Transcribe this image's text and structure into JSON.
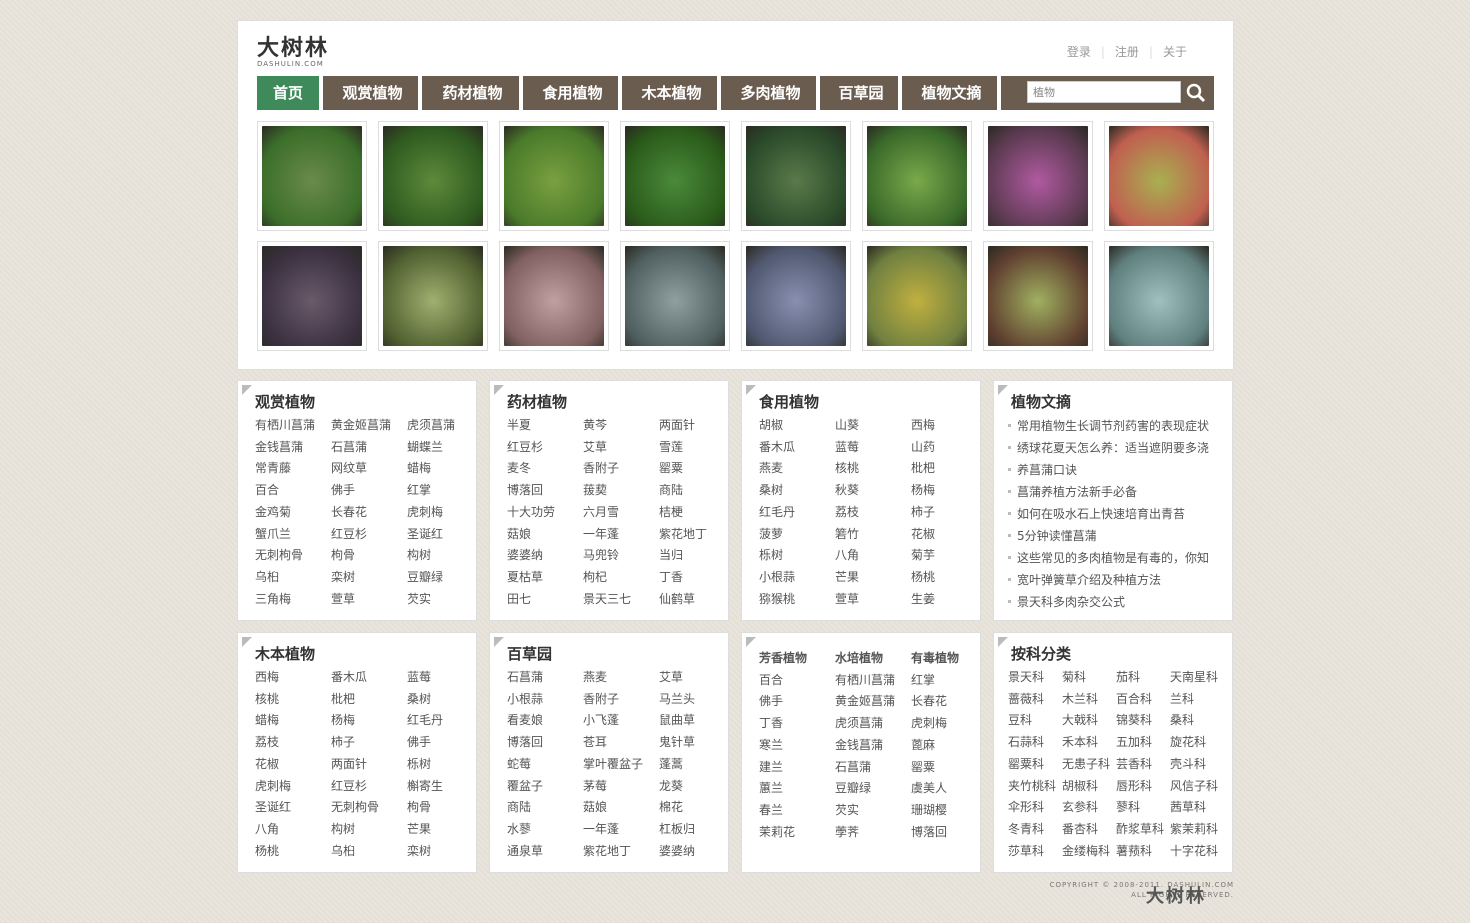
{
  "logo": {
    "main": "大树林",
    "sub": "DASHULIN.COM"
  },
  "toplinks": [
    "登录",
    "注册",
    "关于"
  ],
  "nav": [
    {
      "label": "首页",
      "active": true
    },
    {
      "label": "观赏植物"
    },
    {
      "label": "药材植物"
    },
    {
      "label": "食用植物"
    },
    {
      "label": "木本植物"
    },
    {
      "label": "多肉植物"
    },
    {
      "label": "百草园"
    },
    {
      "label": "植物文摘"
    }
  ],
  "search": {
    "value": "植物"
  },
  "thumb_colors": [
    [
      "#6a8a4a",
      "#3b6e2a"
    ],
    [
      "#5d8a3a",
      "#2f5a20"
    ],
    [
      "#7aa040",
      "#4a7a2a"
    ],
    [
      "#4a8a3a",
      "#2a5a1a"
    ],
    [
      "#5a7a4a",
      "#2a4a2a"
    ],
    [
      "#7aa84a",
      "#3a6a2a"
    ],
    [
      "#b05aa0",
      "#5a3a50"
    ],
    [
      "#a8b050",
      "#c06050"
    ],
    [
      "#6a5a6a",
      "#3a3040"
    ],
    [
      "#a0b070",
      "#506030"
    ],
    [
      "#c0a0a0",
      "#806060"
    ],
    [
      "#90a0a0",
      "#506060"
    ],
    [
      "#8890b0",
      "#505870"
    ],
    [
      "#c0b040",
      "#708040"
    ],
    [
      "#a0b060",
      "#604030"
    ],
    [
      "#a0c0c0",
      "#608080"
    ]
  ],
  "boxes": {
    "ornamental": {
      "title": "观赏植物",
      "cols": [
        [
          "有栖川菖蒲",
          "金钱菖蒲",
          "常青藤",
          "百合",
          "金鸡菊",
          "蟹爪兰",
          "无刺枸骨",
          "乌桕",
          "三角梅"
        ],
        [
          "黄金姬菖蒲",
          "石菖蒲",
          "网纹草",
          "佛手",
          "长春花",
          "红豆杉",
          "枸骨",
          "栾树",
          "萱草"
        ],
        [
          "虎须菖蒲",
          "蝴蝶兰",
          "蜡梅",
          "红掌",
          "虎刺梅",
          "圣诞红",
          "构树",
          "豆瓣绿",
          "芡实"
        ]
      ]
    },
    "medicinal": {
      "title": "药材植物",
      "cols": [
        [
          "半夏",
          "红豆杉",
          "麦冬",
          "博落回",
          "十大功劳",
          "菇娘",
          "婆婆纳",
          "夏枯草",
          "田七"
        ],
        [
          "黄芩",
          "艾草",
          "香附子",
          "菝葜",
          "六月雪",
          "一年蓬",
          "马兜铃",
          "枸杞",
          "景天三七"
        ],
        [
          "两面针",
          "雪莲",
          "罂粟",
          "商陆",
          "桔梗",
          "紫花地丁",
          "当归",
          "丁香",
          "仙鹤草"
        ]
      ]
    },
    "edible": {
      "title": "食用植物",
      "cols": [
        [
          "胡椒",
          "番木瓜",
          "燕麦",
          "桑树",
          "红毛丹",
          "菠萝",
          "栎树",
          "小根蒜",
          "猕猴桃"
        ],
        [
          "山葵",
          "蓝莓",
          "核桃",
          "秋葵",
          "荔枝",
          "箬竹",
          "八角",
          "芒果",
          "萱草"
        ],
        [
          "西梅",
          "山药",
          "枇杷",
          "杨梅",
          "柿子",
          "花椒",
          "菊芋",
          "杨桃",
          "生姜"
        ]
      ]
    },
    "articles": {
      "title": "植物文摘",
      "items": [
        "常用植物生长调节剂药害的表现症状",
        "绣球花夏天怎么养：适当遮阴要多浇",
        "养菖蒲口诀",
        "菖蒲养植方法新手必备",
        "如何在吸水石上快速培育出青苔",
        "5分钟读懂菖蒲",
        "这些常见的多肉植物是有毒的，你知",
        "宽叶弹簧草介绍及种植方法",
        "景天科多肉杂交公式"
      ]
    },
    "woody": {
      "title": "木本植物",
      "cols": [
        [
          "西梅",
          "核桃",
          "蜡梅",
          "荔枝",
          "花椒",
          "虎刺梅",
          "圣诞红",
          "八角",
          "杨桃"
        ],
        [
          "番木瓜",
          "枇杷",
          "杨梅",
          "柿子",
          "两面针",
          "红豆杉",
          "无刺枸骨",
          "构树",
          "乌桕"
        ],
        [
          "蓝莓",
          "桑树",
          "红毛丹",
          "佛手",
          "栎树",
          "槲寄生",
          "枸骨",
          "芒果",
          "栾树"
        ]
      ]
    },
    "herbs": {
      "title": "百草园",
      "cols": [
        [
          "石菖蒲",
          "小根蒜",
          "看麦娘",
          "博落回",
          "蛇莓",
          "覆盆子",
          "商陆",
          "水蓼",
          "通泉草"
        ],
        [
          "燕麦",
          "香附子",
          "小飞蓬",
          "苍耳",
          "掌叶覆盆子",
          "茅莓",
          "菇娘",
          "一年蓬",
          "紫花地丁"
        ],
        [
          "艾草",
          "马兰头",
          "鼠曲草",
          "鬼针草",
          "蓬蒿",
          "龙葵",
          "棉花",
          "杠板归",
          "婆婆纳"
        ]
      ]
    },
    "categories": {
      "cols": [
        {
          "title": "芳香植物",
          "items": [
            "百合",
            "佛手",
            "丁香",
            "寒兰",
            "建兰",
            "蕙兰",
            "春兰",
            "茉莉花"
          ]
        },
        {
          "title": "水培植物",
          "items": [
            "有栖川菖蒲",
            "黄金姬菖蒲",
            "虎须菖蒲",
            "金钱菖蒲",
            "石菖蒲",
            "豆瓣绿",
            "芡实",
            "荸荠"
          ]
        },
        {
          "title": "有毒植物",
          "items": [
            "红掌",
            "长春花",
            "虎刺梅",
            "蓖麻",
            "罂粟",
            "虞美人",
            "珊瑚樱",
            "博落回"
          ]
        }
      ]
    },
    "families": {
      "title": "按科分类",
      "cols": [
        [
          "景天科",
          "蔷薇科",
          "豆科",
          "石蒜科",
          "罂粟科",
          "夹竹桃科",
          "伞形科",
          "冬青科",
          "莎草科"
        ],
        [
          "菊科",
          "木兰科",
          "大戟科",
          "禾本科",
          "无患子科",
          "胡椒科",
          "玄参科",
          "番杏科",
          "金缕梅科"
        ],
        [
          "茄科",
          "百合科",
          "锦葵科",
          "五加科",
          "芸香科",
          "唇形科",
          "蓼科",
          "酢浆草科",
          "薯蓣科"
        ],
        [
          "天南星科",
          "兰科",
          "桑科",
          "旋花科",
          "壳斗科",
          "风信子科",
          "茜草科",
          "紫茉莉科",
          "十字花科"
        ]
      ]
    }
  },
  "footer": {
    "line1": "COPYRIGHT © 2008-2011. DASHULIN.COM",
    "line2": "ALL RIGHTS RESERVED.",
    "logo": "大树林"
  }
}
